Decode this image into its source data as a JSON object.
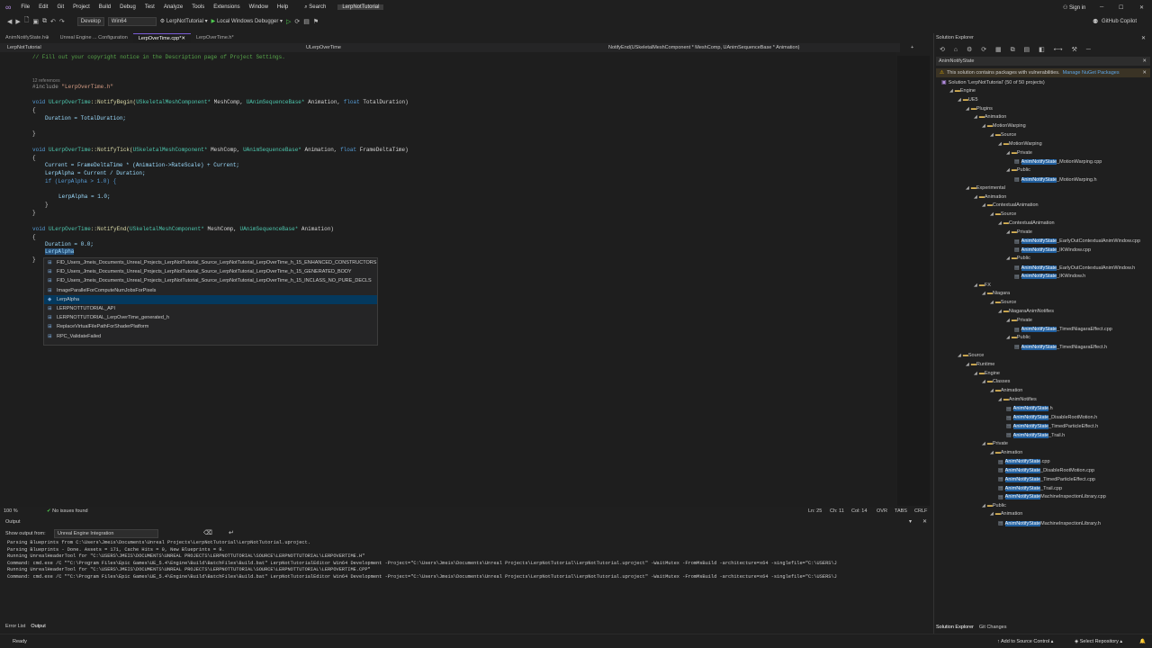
{
  "menu": [
    "File",
    "Edit",
    "Git",
    "Project",
    "Build",
    "Debug",
    "Test",
    "Analyze",
    "Tools",
    "Extensions",
    "Window",
    "Help"
  ],
  "search_label": "Search",
  "solution_title": "LerpNotTutorial",
  "sign_in": "Sign in",
  "copilot": "GitHub Copilot",
  "toolbar": {
    "config": "Develop",
    "platform": "Win64",
    "startup": "LerpNotTutorial",
    "debugger": "Local Windows Debugger"
  },
  "tabs": [
    {
      "label": "AnimNotifyState.h"
    },
    {
      "label": "Unreal Engine ... Configuration"
    },
    {
      "label": "LerpOverTime.cpp*"
    },
    {
      "label": "LerpOverTime.h*"
    }
  ],
  "nav": {
    "project": "LerpNotTutorial",
    "scope": "ULerpOverTime",
    "member": "NotifyEnd(USkeletalMeshComponent * MeshComp, UAnimSequenceBase * Animation)"
  },
  "code": {
    "l1": "// Fill out your copyright notice in the Description page of Project Settings.",
    "refs": "12 references",
    "include_kw": "#include",
    "include_str": "\"LerpOverTime.h\"",
    "nb_void": "void",
    "nb_cls": "ULerpOverTime",
    "nb_fn": "::NotifyBegin(",
    "nb_t1": "USkeletalMeshComponent*",
    "nb_p1": " MeshComp, ",
    "nb_t2": "UAnimSequenceBase*",
    "nb_p2": " Animation, ",
    "nb_t3": "float",
    "nb_p3": " TotalDuration)",
    "ob": "{",
    "cb": "}",
    "dur_assign": "Duration = TotalDuration;",
    "nt_void": "void",
    "nt_cls": "ULerpOverTime",
    "nt_fn": "::NotifyTick(",
    "nt_t1": "USkeletalMeshComponent*",
    "nt_p1": " MeshComp, ",
    "nt_t2": "UAnimSequenceBase*",
    "nt_p2": " Animation, ",
    "nt_t3": "float",
    "nt_p3": " FrameDeltaTime)",
    "cur_line": "Current = FrameDeltaTime * (Animation->RateScale) + Current;",
    "lerp_line": "LerpAlpha = Current / Duration;",
    "if_line": "if (LerpAlpha > 1.0) {",
    "lerp_set": "LerpAlpha = 1.0;",
    "ne_void": "void",
    "ne_cls": "ULerpOverTime",
    "ne_fn": "::NotifyEnd(",
    "ne_t1": "USkeletalMeshComponent*",
    "ne_p1": " MeshComp, ",
    "ne_t2": "UAnimSequenceBase*",
    "ne_p2": " Animation)",
    "dur_zero": "Duration = 0.0;",
    "typing": "LerpAlpha"
  },
  "autocomplete": [
    "FID_Users_Jmeis_Documents_Unreal_Projects_LerpNotTutorial_Source_LerpNotTutorial_LerpOverTime_h_15_ENHANCED_CONSTRUCTORS",
    "FID_Users_Jmeis_Documents_Unreal_Projects_LerpNotTutorial_Source_LerpNotTutorial_LerpOverTime_h_15_GENERATED_BODY",
    "FID_Users_Jmeis_Documents_Unreal_Projects_LerpNotTutorial_Source_LerpNotTutorial_LerpOverTime_h_15_INCLASS_NO_PURE_DECLS",
    "ImageParallelForComputeNumJobsForPixels",
    "LerpAlpha",
    "LERPNOTTUTORIAL_API",
    "LERPNOTTUTORIAL_LerpOverTime_generated_h",
    "ReplaceVirtualFilePathForShaderPlatform",
    "RPC_ValidateFailed"
  ],
  "editor_status": {
    "zoom": "100 %",
    "issues": "No issues found",
    "ln": "Ln: 25",
    "ch": "Ch: 11",
    "col": "Col: 14",
    "ovr": "OVR",
    "tabs": "TABS",
    "crlf": "CRLF"
  },
  "output": {
    "title": "Output",
    "show_from": "Show output from:",
    "source": "Unreal Engine Integration",
    "lines": [
      "Parsing Blueprints from C:\\Users\\Jmeis\\Documents\\Unreal Projects\\LerpNotTutorial\\LerpNotTutorial.uproject.",
      "Parsing Blueprints - Done. Assets = 171, Cache Hits = 0, New Blueprints = 9.",
      "Running UnrealHeaderTool for \"C:\\USERS\\JMEIS\\DOCUMENTS\\UNREAL PROJECTS\\LERPNOTTUTORIAL\\SOURCE\\LERPNOTTUTORIAL\\LERPOVERTIME.H\"",
      "Command: cmd.exe /C \"\"C:\\Program Files\\Epic Games\\UE_5.4\\Engine\\Build\\BatchFiles\\Build.bat\" LerpNotTutorialEditor Win64 Development -Project=\"C:\\Users\\Jmeis\\Documents\\Unreal Projects\\LerpNotTutorial\\LerpNotTutorial.uproject\" -WaitMutex -FromMsBuild -architecture=x64 -singlefile=\"C:\\USERS\\J",
      "Running UnrealHeaderTool for \"C:\\USERS\\JMEIS\\DOCUMENTS\\UNREAL PROJECTS\\LERPNOTTUTORIAL\\SOURCE\\LERPNOTTUTORIAL\\LERPOVERTIME.CPP\"",
      "Command: cmd.exe /C \"\"C:\\Program Files\\Epic Games\\UE_5.4\\Engine\\Build\\BatchFiles\\Build.bat\" LerpNotTutorialEditor Win64 Development -Project=\"C:\\Users\\Jmeis\\Documents\\Unreal Projects\\LerpNotTutorial\\LerpNotTutorial.uproject\" -WaitMutex -FromMsBuild -architecture=x64 -singlefile=\"C:\\USERS\\J"
    ]
  },
  "bottom_tabs": {
    "error_list": "Error List",
    "output": "Output"
  },
  "solution_explorer": {
    "title": "Solution Explorer",
    "search": "AnimNotifyState",
    "warning": "This solution contains packages with vulnerabilities.",
    "manage": "Manage NuGet Packages",
    "solution": "Solution 'LerpNotTutorial' (50 of 50 projects)"
  },
  "tree": [
    {
      "pre": "",
      "hl": "",
      "post": "Engine",
      "kind": "folder"
    },
    {
      "pre": "",
      "hl": "",
      "post": "UE5",
      "kind": "folder"
    },
    {
      "pre": "",
      "hl": "",
      "post": "Plugins",
      "kind": "folder"
    },
    {
      "pre": "",
      "hl": "",
      "post": "Animation",
      "kind": "folder"
    },
    {
      "pre": "",
      "hl": "",
      "post": "MotionWarping",
      "kind": "folder"
    },
    {
      "pre": "",
      "hl": "",
      "post": "Source",
      "kind": "folder"
    },
    {
      "pre": "",
      "hl": "",
      "post": "MotionWarping",
      "kind": "folder"
    },
    {
      "pre": "",
      "hl": "",
      "post": "Private",
      "kind": "folder"
    },
    {
      "pre": "",
      "hl": "AnimNotifyState",
      "post": "_MotionWarping.cpp",
      "kind": "file"
    },
    {
      "pre": "",
      "hl": "",
      "post": "Public",
      "kind": "folder"
    },
    {
      "pre": "",
      "hl": "AnimNotifyState",
      "post": "_MotionWarping.h",
      "kind": "file"
    },
    {
      "pre": "",
      "hl": "",
      "post": "Experimental",
      "kind": "folder"
    },
    {
      "pre": "",
      "hl": "",
      "post": "Animation",
      "kind": "folder"
    },
    {
      "pre": "",
      "hl": "",
      "post": "ContextualAnimation",
      "kind": "folder"
    },
    {
      "pre": "",
      "hl": "",
      "post": "Source",
      "kind": "folder"
    },
    {
      "pre": "",
      "hl": "",
      "post": "ContextualAnimation",
      "kind": "folder"
    },
    {
      "pre": "",
      "hl": "",
      "post": "Private",
      "kind": "folder"
    },
    {
      "pre": "",
      "hl": "AnimNotifyState",
      "post": "_EarlyOutContextualAnimWindow.cpp",
      "kind": "file"
    },
    {
      "pre": "",
      "hl": "AnimNotifyState",
      "post": "_IKWindow.cpp",
      "kind": "file"
    },
    {
      "pre": "",
      "hl": "",
      "post": "Public",
      "kind": "folder"
    },
    {
      "pre": "",
      "hl": "AnimNotifyState",
      "post": "_EarlyOutContextualAnimWindow.h",
      "kind": "file"
    },
    {
      "pre": "",
      "hl": "AnimNotifyState",
      "post": "_IKWindow.h",
      "kind": "file"
    },
    {
      "pre": "",
      "hl": "",
      "post": "FX",
      "kind": "folder"
    },
    {
      "pre": "",
      "hl": "",
      "post": "Niagara",
      "kind": "folder"
    },
    {
      "pre": "",
      "hl": "",
      "post": "Source",
      "kind": "folder"
    },
    {
      "pre": "",
      "hl": "",
      "post": "NiagaraAnimNotifies",
      "kind": "folder"
    },
    {
      "pre": "",
      "hl": "",
      "post": "Private",
      "kind": "folder"
    },
    {
      "pre": "",
      "hl": "AnimNotifyState",
      "post": "_TimedNiagaraEffect.cpp",
      "kind": "file"
    },
    {
      "pre": "",
      "hl": "",
      "post": "Public",
      "kind": "folder"
    },
    {
      "pre": "",
      "hl": "AnimNotifyState",
      "post": "_TimedNiagaraEffect.h",
      "kind": "file"
    },
    {
      "pre": "",
      "hl": "",
      "post": "Source",
      "kind": "folder"
    },
    {
      "pre": "",
      "hl": "",
      "post": "Runtime",
      "kind": "folder"
    },
    {
      "pre": "",
      "hl": "",
      "post": "Engine",
      "kind": "folder"
    },
    {
      "pre": "",
      "hl": "",
      "post": "Classes",
      "kind": "folder"
    },
    {
      "pre": "",
      "hl": "",
      "post": "Animation",
      "kind": "folder"
    },
    {
      "pre": "",
      "hl": "",
      "post": "AnimNotifies",
      "kind": "folder"
    },
    {
      "pre": "",
      "hl": "AnimNotifyState",
      "post": ".h",
      "kind": "file"
    },
    {
      "pre": "",
      "hl": "AnimNotifyState",
      "post": "_DisableRootMotion.h",
      "kind": "file"
    },
    {
      "pre": "",
      "hl": "AnimNotifyState",
      "post": "_TimedParticleEffect.h",
      "kind": "file"
    },
    {
      "pre": "",
      "hl": "AnimNotifyState",
      "post": "_Trail.h",
      "kind": "file"
    },
    {
      "pre": "",
      "hl": "",
      "post": "Private",
      "kind": "folder"
    },
    {
      "pre": "",
      "hl": "",
      "post": "Animation",
      "kind": "folder"
    },
    {
      "pre": "",
      "hl": "AnimNotifyState",
      "post": ".cpp",
      "kind": "file"
    },
    {
      "pre": "",
      "hl": "AnimNotifyState",
      "post": "_DisableRootMotion.cpp",
      "kind": "file"
    },
    {
      "pre": "",
      "hl": "AnimNotifyState",
      "post": "_TimedParticleEffect.cpp",
      "kind": "file"
    },
    {
      "pre": "",
      "hl": "AnimNotifyState",
      "post": "_Trail.cpp",
      "kind": "file"
    },
    {
      "pre": "",
      "hl": "AnimNotifyState",
      "post": "MachineInspectionLibrary.cpp",
      "kind": "file"
    },
    {
      "pre": "",
      "hl": "",
      "post": "Public",
      "kind": "folder"
    },
    {
      "pre": "",
      "hl": "",
      "post": "Animation",
      "kind": "folder"
    },
    {
      "pre": "",
      "hl": "AnimNotifyState",
      "post": "MachineInspectionLibrary.h",
      "kind": "file"
    }
  ],
  "se_bottom": {
    "se": "Solution Explorer",
    "git": "Git Changes"
  },
  "status": {
    "ready": "Ready",
    "add_src": "Add to Source Control",
    "select_repo": "Select Repository"
  }
}
